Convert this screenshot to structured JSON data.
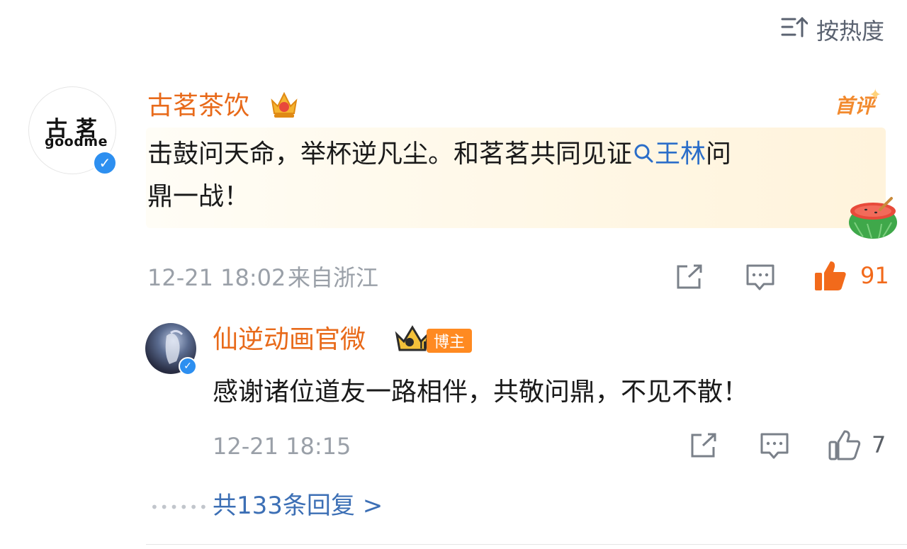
{
  "sort": {
    "label": "按热度"
  },
  "comment": {
    "avatar": {
      "line1": "古茗",
      "line2": "goodme"
    },
    "username": "古茗茶饮",
    "first_badge": "首评",
    "text_before": "击鼓问天命，举杯逆凡尘。和茗茗共同见证",
    "topic": "王林",
    "text_line1_end": "问",
    "text_line2": "鼎一战！",
    "timestamp": "12-21 18:02",
    "location": "来自浙江",
    "like_count": "91",
    "colors": {
      "username": "#e86a1a",
      "topic": "#2b6ec9",
      "liked": "#f26a1b"
    }
  },
  "reply": {
    "username": "仙逆动画官微",
    "badge": "博主",
    "text": "感谢诸位道友一路相伴，共敬问鼎，不见不散！",
    "timestamp": "12-21 18:15",
    "like_count": "7"
  },
  "more_replies": {
    "label": "共133条回复 >"
  }
}
